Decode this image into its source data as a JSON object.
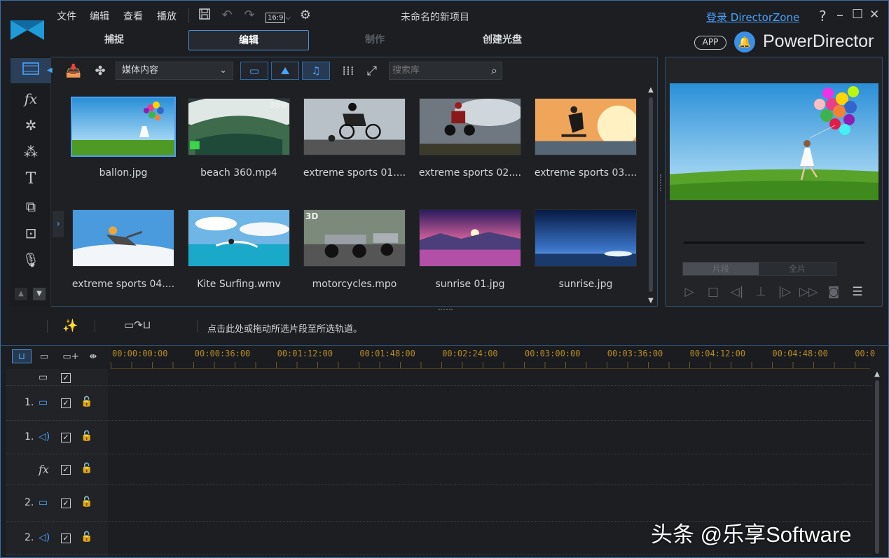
{
  "menu": [
    "文件",
    "编辑",
    "查看",
    "播放"
  ],
  "toolbar_icons": [
    "save-icon",
    "undo-icon",
    "redo-icon",
    "aspect-ratio-icon",
    "settings-gear-icon"
  ],
  "aspect_label": "16:9",
  "project_title": "未命名的新项目",
  "login": "登录 DirectorZone",
  "window_controls": {
    "help": "?",
    "minimize": "–",
    "maximize": "☐",
    "close": "✕"
  },
  "mode_tabs": [
    {
      "label": "捕捉",
      "state": "normal"
    },
    {
      "label": "编辑",
      "state": "active"
    },
    {
      "label": "制作",
      "state": "disabled"
    },
    {
      "label": "创建光盘",
      "state": "normal"
    }
  ],
  "app_badge": "APP",
  "brand": "PowerDirector",
  "side_tools": [
    "media-room-icon",
    "fx-icon",
    "pip-icon",
    "particle-icon",
    "title-icon",
    "transition-icon",
    "subtitle-icon",
    "voice-over-icon"
  ],
  "library": {
    "dropdown_value": "媒体内容",
    "search_placeholder": "搜索库",
    "view_filters": [
      "video-filter-icon",
      "image-filter-icon",
      "audio-filter-icon"
    ],
    "items": [
      {
        "label": "ballon.jpg",
        "scene": "balloon",
        "selected": true
      },
      {
        "label": "beach 360.mp4",
        "scene": "beach",
        "badge": "360"
      },
      {
        "label": "extreme sports 01....",
        "scene": "bmx"
      },
      {
        "label": "extreme sports 02....",
        "scene": "moto-jump"
      },
      {
        "label": "extreme sports 03....",
        "scene": "skate"
      },
      {
        "label": "extreme sports 04....",
        "scene": "skydive"
      },
      {
        "label": "Kite Surfing.wmv",
        "scene": "kitesurf"
      },
      {
        "label": "motorcycles.mpo",
        "scene": "motorcycles",
        "badge3d": "3D"
      },
      {
        "label": "sunrise 01.jpg",
        "scene": "sunrise1"
      },
      {
        "label": "sunrise.jpg",
        "scene": "sunrise2"
      }
    ]
  },
  "preview": {
    "segment_left": "片段",
    "segment_right": "全片"
  },
  "hint": "点击此处或拖动所选片段至所选轨道。",
  "ruler_ticks": [
    "00:00:00:00",
    "00:00:36:00",
    "00:01:12:00",
    "00:01:48:00",
    "00:02:24:00",
    "00:03:00:00",
    "00:03:36:00",
    "00:04:12:00",
    "00:04:48:00",
    "00:0"
  ],
  "tracks": [
    {
      "num": "",
      "type": "header"
    },
    {
      "num": "1.",
      "type": "video"
    },
    {
      "num": "1.",
      "type": "audio"
    },
    {
      "num": "",
      "type": "fx"
    },
    {
      "num": "2.",
      "type": "video"
    },
    {
      "num": "2.",
      "type": "audio"
    }
  ],
  "watermark": "头条 @乐享Software",
  "colors": {
    "accent": "#4aa3ff",
    "panel_border": "#2f4e6e",
    "ruler_text": "#b78a2c"
  }
}
